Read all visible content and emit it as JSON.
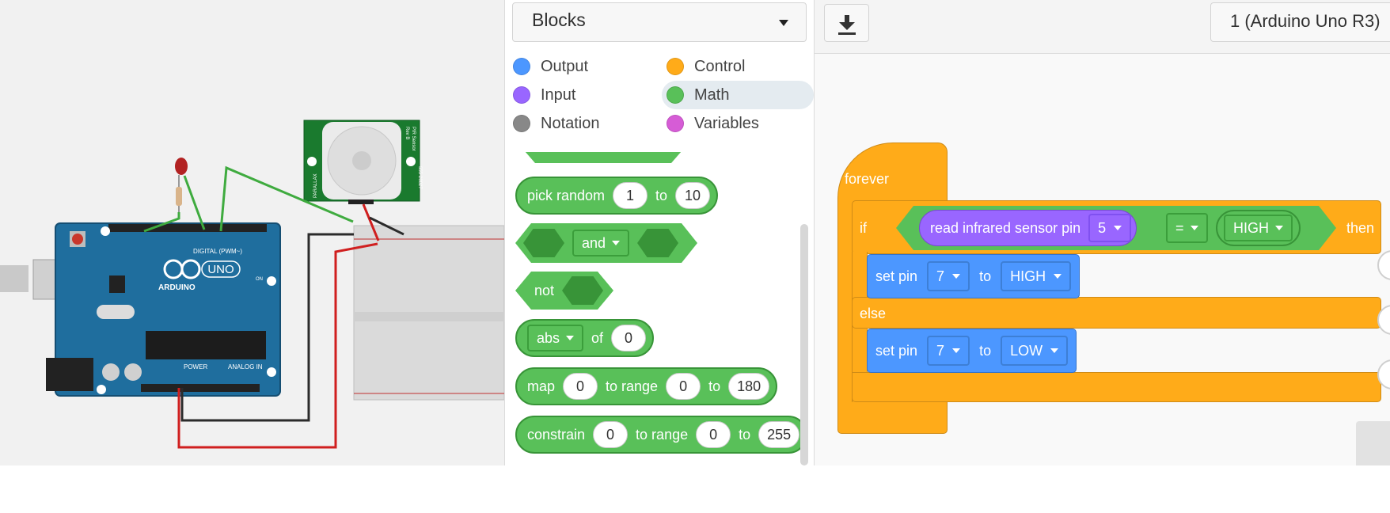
{
  "palette": {
    "dropdown_label": "Blocks",
    "categories": [
      {
        "label": "Output",
        "color": "#4c97ff"
      },
      {
        "label": "Control",
        "color": "#ffab19"
      },
      {
        "label": "Input",
        "color": "#9966ff"
      },
      {
        "label": "Math",
        "color": "#59c059",
        "selected": true
      },
      {
        "label": "Notation",
        "color": "#888888"
      },
      {
        "label": "Variables",
        "color": "#d65cd6"
      }
    ],
    "blocks": {
      "pick_random": {
        "label": "pick random",
        "from": "1",
        "to_label": "to",
        "to": "10"
      },
      "and": {
        "op": "and"
      },
      "not": {
        "label": "not"
      },
      "abs": {
        "fn": "abs",
        "of_label": "of",
        "value": "0"
      },
      "map": {
        "label": "map",
        "value": "0",
        "range_label": "to range",
        "low": "0",
        "to_label": "to",
        "high": "180"
      },
      "constrain": {
        "label": "constrain",
        "value": "0",
        "range_label": "to range",
        "low": "0",
        "to_label": "to",
        "high": "255"
      }
    }
  },
  "workspace": {
    "device_label": "1 (Arduino Uno R3)",
    "program": {
      "forever_label": "forever",
      "if_label": "if",
      "then_label": "then",
      "else_label": "else",
      "condition": {
        "sensor_label": "read infrared sensor pin",
        "pin": "5",
        "operator": "=",
        "value": "HIGH"
      },
      "then_action": {
        "label": "set pin",
        "pin": "7",
        "to_label": "to",
        "value": "HIGH"
      },
      "else_action": {
        "label": "set pin",
        "pin": "7",
        "to_label": "to",
        "value": "LOW"
      }
    }
  },
  "circuit": {
    "board_brand": "ARDUINO",
    "board_model": "UNO",
    "digital_label": "DIGITAL (PWM~)",
    "power_label": "POWER",
    "analog_label": "ANALOG IN",
    "on_label": "ON",
    "sensor_label": "PIR Sensor",
    "sensor_rev": "Rev B",
    "sensor_part": "555-28027",
    "sensor_brand": "PARALLAX"
  }
}
